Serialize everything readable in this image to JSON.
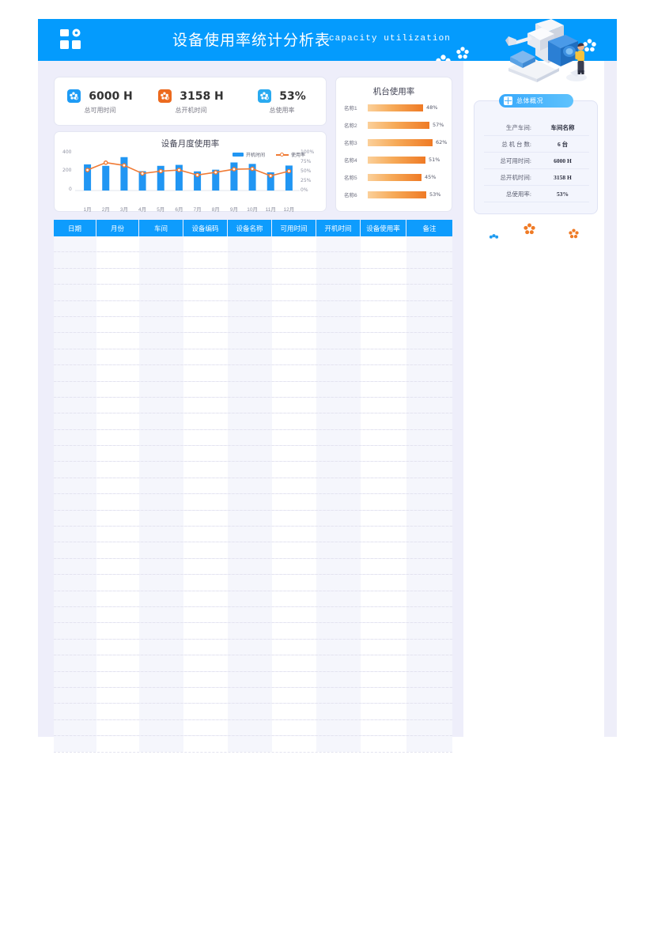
{
  "header": {
    "title": "设备使用率统计分析表",
    "subtitle": "capacity utilization",
    "logo_icon": "grid-gear-icon",
    "illustration": "cnc-machine-worker-illustration",
    "bg_color": "#049bfd",
    "flowers": [
      "flower-icon",
      "flower-icon",
      "flower-icon"
    ]
  },
  "kpi": {
    "items": [
      {
        "value": "6000 H",
        "label": "总可用时间",
        "icon": "flower-badge-icon",
        "color": "#1d9bf5"
      },
      {
        "value": "3158 H",
        "label": "总开机时间",
        "icon": "flower-badge-icon",
        "color": "#ec6a1e"
      },
      {
        "value": "53%",
        "label": "总使用率",
        "icon": "flower-badge-icon",
        "color": "#29aaf0"
      }
    ]
  },
  "chart_data": [
    {
      "type": "bar",
      "title": "设备月度使用率",
      "categories": [
        "1月",
        "2月",
        "3月",
        "4月",
        "5月",
        "6月",
        "7月",
        "8月",
        "9月",
        "10月",
        "11月",
        "12月"
      ],
      "series": [
        {
          "name": "开机时间",
          "type": "bar",
          "color": "#2196f3",
          "values": [
            270,
            255,
            345,
            200,
            255,
            265,
            198,
            215,
            290,
            275,
            188,
            258
          ]
        },
        {
          "name": "使用率",
          "type": "line",
          "color": "#f07b35",
          "axis": "right",
          "values": [
            53,
            72,
            65,
            44,
            50,
            53,
            40,
            47,
            55,
            56,
            38,
            50
          ]
        }
      ],
      "xlabel": "",
      "ylabel": "",
      "ylim": [
        0,
        400
      ],
      "yticks": [
        "0",
        "200",
        "400"
      ],
      "y2lim": [
        0,
        100
      ],
      "y2ticks": [
        "0%",
        "25%",
        "50%",
        "75%",
        "100%"
      ],
      "grid": false,
      "legend": "top-right"
    },
    {
      "type": "bar",
      "title": "机台使用率",
      "orientation": "horizontal",
      "categories": [
        "名称1",
        "名称2",
        "名称3",
        "名称4",
        "名称5",
        "名称6"
      ],
      "values": [
        48,
        57,
        62,
        51,
        45,
        53
      ],
      "labels": [
        "48%",
        "57%",
        "62%",
        "51%",
        "45%",
        "53%"
      ],
      "xlabel": "",
      "ylabel": "",
      "xlim": [
        0,
        100
      ],
      "grid": false,
      "legend": "none",
      "gradient": [
        "#fbd09a",
        "#ef7a25"
      ]
    }
  ],
  "overview": {
    "badge": "总体概况",
    "badge_icon": "grid-icon",
    "rows": [
      {
        "key": "生产车间:",
        "value": "车间名称"
      },
      {
        "key": "总 机 台 数:",
        "value": "6 台"
      },
      {
        "key": "总可用时间:",
        "value": "6000 H"
      },
      {
        "key": "总开机时间:",
        "value": "3158 H"
      },
      {
        "key": "总使用率:",
        "value": "53%"
      }
    ]
  },
  "decor_flowers": [
    {
      "icon": "flower-icon",
      "color": "#1f9bf0"
    },
    {
      "icon": "flower-icon",
      "color": "#ef7a25"
    },
    {
      "icon": "flower-icon",
      "color": "#ef7a25"
    }
  ],
  "table": {
    "columns": [
      {
        "label": "日期",
        "width": 54
      },
      {
        "label": "月份",
        "width": 54
      },
      {
        "label": "车间",
        "width": 56
      },
      {
        "label": "设备编码",
        "width": 56
      },
      {
        "label": "设备名称",
        "width": 56
      },
      {
        "label": "可用时间",
        "width": 56
      },
      {
        "label": "开机时间",
        "width": 56
      },
      {
        "label": "设备使用率",
        "width": 58
      },
      {
        "label": "备注",
        "width": 58
      }
    ],
    "rows": [],
    "empty_row_count": 32
  }
}
